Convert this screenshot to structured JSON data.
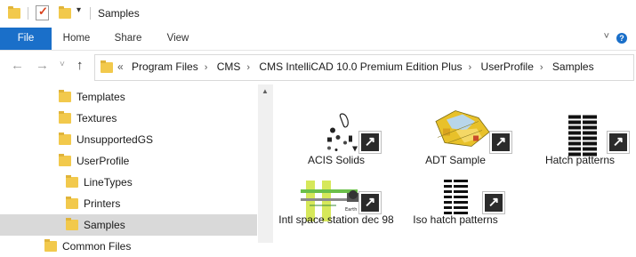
{
  "window": {
    "title": "Samples"
  },
  "ribbon": {
    "tabs": [
      "File",
      "Home",
      "Share",
      "View"
    ],
    "help_label": "?"
  },
  "address": {
    "leading": "«",
    "crumbs": [
      "Program Files",
      "CMS",
      "CMS IntelliCAD 10.0 Premium Edition Plus",
      "UserProfile",
      "Samples"
    ],
    "separator": "›"
  },
  "nav_pane": {
    "items": [
      {
        "label": "Templates",
        "selected": false
      },
      {
        "label": "Textures",
        "selected": false
      },
      {
        "label": "UnsupportedGS",
        "selected": false
      },
      {
        "label": "UserProfile",
        "selected": false
      },
      {
        "label": "LineTypes",
        "selected": false
      },
      {
        "label": "Printers",
        "selected": false
      },
      {
        "label": "Samples",
        "selected": true
      },
      {
        "label": "Common Files",
        "selected": false
      }
    ]
  },
  "files": [
    {
      "name": "ACIS Solids",
      "icon": "acis-solids-thumbnail"
    },
    {
      "name": "ADT Sample",
      "icon": "adt-sample-thumbnail"
    },
    {
      "name": "Hatch patterns",
      "icon": "hatch-patterns-thumbnail"
    },
    {
      "name": "Intl space station dec 98",
      "icon": "space-station-thumbnail"
    },
    {
      "name": "Iso hatch patterns",
      "icon": "iso-hatch-thumbnail"
    }
  ],
  "colors": {
    "accent": "#1a6fc9",
    "folder": "#f2c94c",
    "selection": "#d9d9d9"
  }
}
